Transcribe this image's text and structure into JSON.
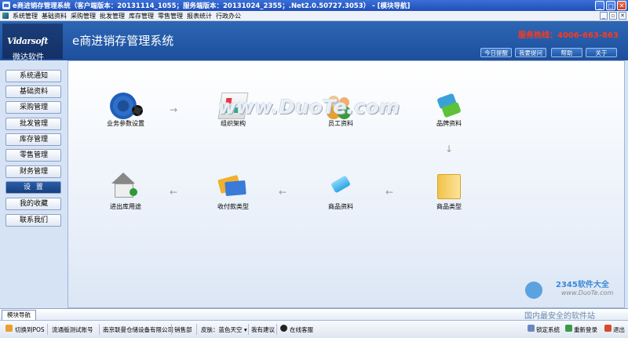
{
  "window": {
    "title": "e商进销存管理系统（客户端版本：20131114_1055；服务端版本：20131024_2355；.Net2.0.50727.3053） - [模块导航]",
    "controls": [
      "_",
      "□",
      "✕"
    ]
  },
  "menubar": {
    "items": [
      "系统管理",
      "基础资料",
      "采购管理",
      "批发管理",
      "库存管理",
      "零售管理",
      "报表统计",
      "行政办公"
    ],
    "mdi_controls": [
      "_",
      "▫",
      "✕"
    ]
  },
  "header": {
    "logo_en": "Vidarsoft",
    "logo_cn": "微达软件",
    "app_title": "e商进销存管理系统",
    "hotline": "服务热线：4006-663-863",
    "buttons": [
      "今日提醒",
      "我要提问",
      "帮助",
      "关于"
    ]
  },
  "sidebar": {
    "items": [
      "系统通知",
      "基础资料",
      "采购管理",
      "批发管理",
      "库存管理",
      "零售管理",
      "财务管理",
      "设  置",
      "我的收藏",
      "联系我们"
    ],
    "active_index": 7
  },
  "flow": {
    "row1": [
      "业务参数设置",
      "组织架构",
      "员工资料",
      "品牌资料"
    ],
    "row2": [
      "进出库用途",
      "收付款类型",
      "商品资料",
      "商品类型"
    ]
  },
  "watermark": "www.DuoTe.com",
  "brand_badge": {
    "main": "2345软件大全",
    "url": "www.DuoTe.com"
  },
  "tabstrip": {
    "tab": "模块导航",
    "site": "国内最安全的软件站"
  },
  "statusbar": {
    "items": [
      "切换到POS",
      "流通版测试账号",
      "南京联曼仓储设备有限公司",
      "销售部",
      "皮肤：蓝色天空 ▾",
      "我有建议",
      "在线客服"
    ],
    "right": [
      "锁定系统",
      "重新登录",
      "退出"
    ]
  },
  "colors": {
    "header": "#1d4f9d",
    "hotline": "#ff3a1a",
    "active_nav": "#163f80"
  }
}
